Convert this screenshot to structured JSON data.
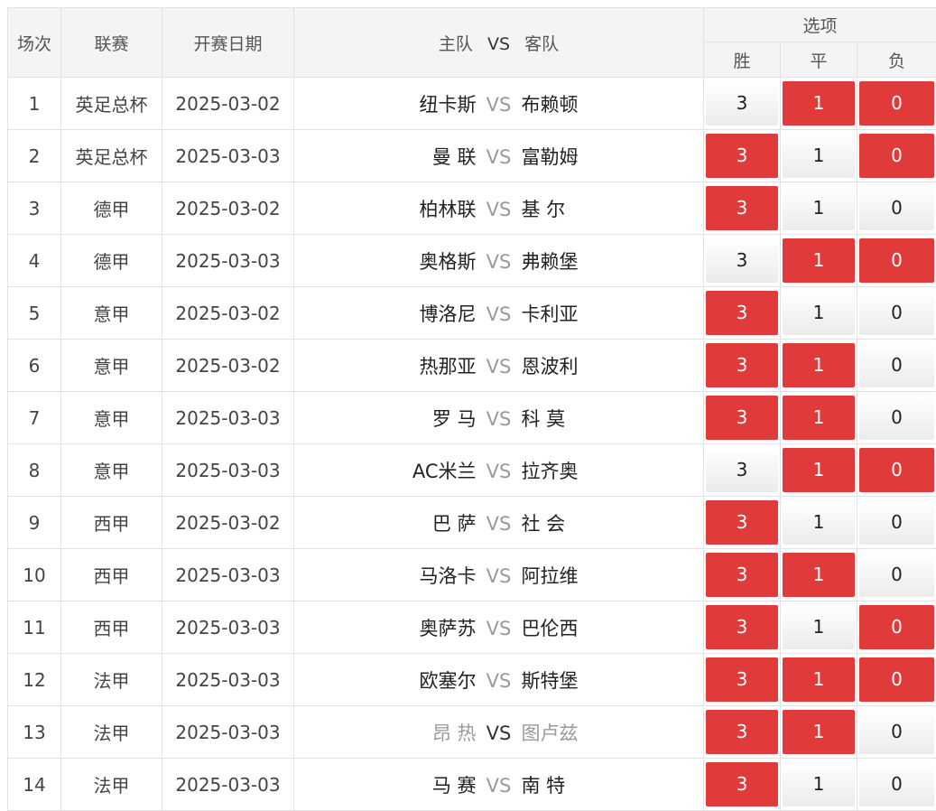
{
  "header": {
    "round": "场次",
    "league": "联赛",
    "date": "开赛日期",
    "home": "主队",
    "vs": "VS",
    "away": "客队",
    "options": "选项",
    "win": "胜",
    "draw": "平",
    "lose": "负"
  },
  "colors": {
    "selected": "#e13a3b",
    "border": "#e2e2e2",
    "header_bg": "#f4f4f4"
  },
  "rows": [
    {
      "no": "1",
      "league": "英足总杯",
      "date": "2025-03-02",
      "home": "纽卡斯",
      "vs": "VS",
      "away": "布赖顿",
      "w": "3",
      "d": "1",
      "l": "0",
      "sel": [
        false,
        true,
        true
      ],
      "dim": false
    },
    {
      "no": "2",
      "league": "英足总杯",
      "date": "2025-03-03",
      "home": "曼 联",
      "vs": "VS",
      "away": "富勒姆",
      "w": "3",
      "d": "1",
      "l": "0",
      "sel": [
        true,
        false,
        true
      ],
      "dim": false
    },
    {
      "no": "3",
      "league": "德甲",
      "date": "2025-03-02",
      "home": "柏林联",
      "vs": "VS",
      "away": "基 尔",
      "w": "3",
      "d": "1",
      "l": "0",
      "sel": [
        true,
        false,
        false
      ],
      "dim": false
    },
    {
      "no": "4",
      "league": "德甲",
      "date": "2025-03-03",
      "home": "奥格斯",
      "vs": "VS",
      "away": "弗赖堡",
      "w": "3",
      "d": "1",
      "l": "0",
      "sel": [
        false,
        true,
        true
      ],
      "dim": false
    },
    {
      "no": "5",
      "league": "意甲",
      "date": "2025-03-02",
      "home": "博洛尼",
      "vs": "VS",
      "away": "卡利亚",
      "w": "3",
      "d": "1",
      "l": "0",
      "sel": [
        true,
        false,
        false
      ],
      "dim": false
    },
    {
      "no": "6",
      "league": "意甲",
      "date": "2025-03-02",
      "home": "热那亚",
      "vs": "VS",
      "away": "恩波利",
      "w": "3",
      "d": "1",
      "l": "0",
      "sel": [
        true,
        true,
        false
      ],
      "dim": false
    },
    {
      "no": "7",
      "league": "意甲",
      "date": "2025-03-03",
      "home": "罗 马",
      "vs": "VS",
      "away": "科 莫",
      "w": "3",
      "d": "1",
      "l": "0",
      "sel": [
        true,
        true,
        false
      ],
      "dim": false
    },
    {
      "no": "8",
      "league": "意甲",
      "date": "2025-03-03",
      "home": "AC米兰",
      "vs": "VS",
      "away": "拉齐奥",
      "w": "3",
      "d": "1",
      "l": "0",
      "sel": [
        false,
        true,
        true
      ],
      "dim": false
    },
    {
      "no": "9",
      "league": "西甲",
      "date": "2025-03-02",
      "home": "巴 萨",
      "vs": "VS",
      "away": "社 会",
      "w": "3",
      "d": "1",
      "l": "0",
      "sel": [
        true,
        false,
        false
      ],
      "dim": false
    },
    {
      "no": "10",
      "league": "西甲",
      "date": "2025-03-03",
      "home": "马洛卡",
      "vs": "VS",
      "away": "阿拉维",
      "w": "3",
      "d": "1",
      "l": "0",
      "sel": [
        true,
        true,
        false
      ],
      "dim": false
    },
    {
      "no": "11",
      "league": "西甲",
      "date": "2025-03-03",
      "home": "奥萨苏",
      "vs": "VS",
      "away": "巴伦西",
      "w": "3",
      "d": "1",
      "l": "0",
      "sel": [
        true,
        false,
        true
      ],
      "dim": false
    },
    {
      "no": "12",
      "league": "法甲",
      "date": "2025-03-03",
      "home": "欧塞尔",
      "vs": "VS",
      "away": "斯特堡",
      "w": "3",
      "d": "1",
      "l": "0",
      "sel": [
        true,
        true,
        true
      ],
      "dim": false
    },
    {
      "no": "13",
      "league": "法甲",
      "date": "2025-03-03",
      "home": "昂 热",
      "vs": "VS",
      "away": "图卢兹",
      "w": "3",
      "d": "1",
      "l": "0",
      "sel": [
        true,
        true,
        false
      ],
      "dim": true
    },
    {
      "no": "14",
      "league": "法甲",
      "date": "2025-03-03",
      "home": "马 赛",
      "vs": "VS",
      "away": "南 特",
      "w": "3",
      "d": "1",
      "l": "0",
      "sel": [
        true,
        false,
        false
      ],
      "dim": false
    }
  ]
}
